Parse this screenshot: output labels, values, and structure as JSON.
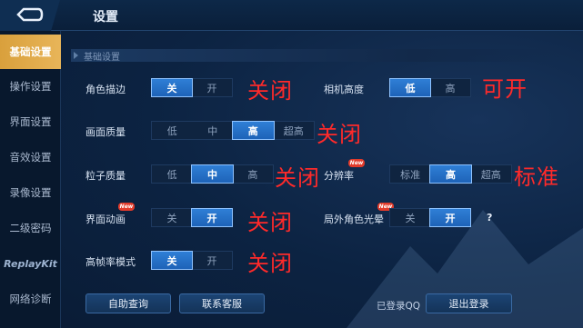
{
  "header": {
    "title": "设置",
    "back_icon": "back-arrow-icon"
  },
  "sidebar": {
    "items": [
      {
        "label": "基础设置",
        "active": true
      },
      {
        "label": "操作设置",
        "active": false
      },
      {
        "label": "界面设置",
        "active": false
      },
      {
        "label": "音效设置",
        "active": false
      },
      {
        "label": "录像设置",
        "active": false
      },
      {
        "label": "二级密码",
        "active": false
      },
      {
        "label": "ReplayKit",
        "active": false
      },
      {
        "label": "网络诊断",
        "active": false
      }
    ]
  },
  "section": {
    "title": "基础设置"
  },
  "settings": {
    "role_outline": {
      "label": "角色描边",
      "options": [
        "关",
        "开"
      ],
      "selected": "关",
      "annotation": "关闭"
    },
    "camera_height": {
      "label": "相机高度",
      "options": [
        "低",
        "高"
      ],
      "selected": "低",
      "annotation": "可开"
    },
    "image_quality": {
      "label": "画面质量",
      "options": [
        "低",
        "中",
        "高",
        "超高"
      ],
      "selected": "高",
      "annotation": "关闭"
    },
    "particle_quality": {
      "label": "粒子质量",
      "options": [
        "低",
        "中",
        "高"
      ],
      "selected": "中",
      "annotation": "关闭"
    },
    "resolution": {
      "label": "分辨率",
      "options": [
        "标准",
        "高",
        "超高"
      ],
      "selected": "高",
      "annotation": "标准",
      "badge": "New"
    },
    "ui_animation": {
      "label": "界面动画",
      "options": [
        "关",
        "开"
      ],
      "selected": "开",
      "annotation": "关闭",
      "badge": "New"
    },
    "outside_glow": {
      "label": "局外角色光晕",
      "options": [
        "关",
        "开"
      ],
      "selected": "开",
      "badge": "New",
      "help": "?"
    },
    "high_fps": {
      "label": "高帧率模式",
      "options": [
        "关",
        "开"
      ],
      "selected": "关",
      "annotation": "关闭"
    }
  },
  "footer": {
    "self_help_label": "自助查询",
    "contact_label": "联系客服",
    "logged_in_text": "已登录QQ",
    "logout_label": "退出登录"
  },
  "colors": {
    "accent": "#2f7fd6",
    "sidebar_active": "#e0a84a",
    "annotation": "#ff2a2a"
  }
}
